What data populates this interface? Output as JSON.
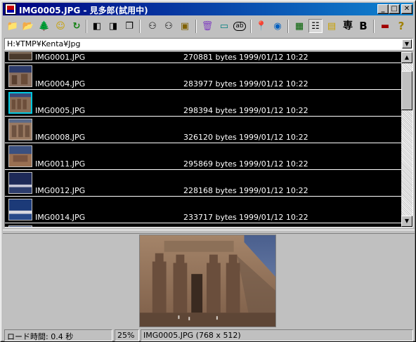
{
  "window": {
    "title": "IMG0005.JPG - 見多郎(試用中)",
    "controls": {
      "minimize": "_",
      "maximize": "□",
      "close": "✕"
    }
  },
  "toolbar": {
    "buttons": [
      {
        "icon": "folder-up-icon",
        "glyph": "📁"
      },
      {
        "icon": "open-folder-icon",
        "glyph": "📂"
      },
      {
        "icon": "tree-icon",
        "glyph": "🌲"
      },
      {
        "icon": "smiley-icon",
        "glyph": "☺"
      },
      {
        "icon": "refresh-icon",
        "glyph": "↻"
      },
      {
        "icon": "prev-page-icon",
        "glyph": "◧"
      },
      {
        "icon": "next-page-icon",
        "glyph": "◨"
      },
      {
        "icon": "copy-page-icon",
        "glyph": "❐"
      },
      {
        "icon": "binoculars-icon",
        "glyph": "⚇"
      },
      {
        "icon": "binoculars-find-next-icon",
        "glyph": "⚇"
      },
      {
        "icon": "monitor-icon",
        "glyph": "▣"
      },
      {
        "icon": "trash-icon",
        "glyph": "🗑"
      },
      {
        "icon": "card-icon",
        "glyph": "▭"
      },
      {
        "icon": "ab-icon",
        "glyph": "ab"
      },
      {
        "icon": "pin-icon",
        "glyph": "📍"
      },
      {
        "icon": "globe-icon",
        "glyph": "◉"
      },
      {
        "icon": "large-icons-view-icon",
        "glyph": "▦"
      },
      {
        "icon": "details-view-icon",
        "glyph": "☷"
      },
      {
        "icon": "color-view-icon",
        "glyph": "▤"
      },
      {
        "icon": "senyo-icon",
        "glyph": "専"
      },
      {
        "icon": "bold-icon",
        "glyph": "B"
      },
      {
        "icon": "slideshow-icon",
        "glyph": "▬"
      },
      {
        "icon": "help-icon",
        "glyph": "?"
      }
    ]
  },
  "path": {
    "value": "H:¥TMP¥Kenta¥Jpg"
  },
  "files": [
    {
      "name": "IMG0001.JPG",
      "size": "270881 bytes",
      "date": "1999/01/12 10:22",
      "selected": false
    },
    {
      "name": "IMG0004.JPG",
      "size": "283977 bytes",
      "date": "1999/01/12 10:22",
      "selected": false
    },
    {
      "name": "IMG0005.JPG",
      "size": "298394 bytes",
      "date": "1999/01/12 10:22",
      "selected": true
    },
    {
      "name": "IMG0008.JPG",
      "size": "326120 bytes",
      "date": "1999/01/12 10:22",
      "selected": false
    },
    {
      "name": "IMG0011.JPG",
      "size": "295869 bytes",
      "date": "1999/01/12 10:22",
      "selected": false
    },
    {
      "name": "IMG0012.JPG",
      "size": "228168 bytes",
      "date": "1999/01/12 10:22",
      "selected": false
    },
    {
      "name": "IMG0014.JPG",
      "size": "233717 bytes",
      "date": "1999/01/12 10:22",
      "selected": false
    }
  ],
  "status": {
    "load_time": "ロード時間: 0.4 秒",
    "zoom": "25%",
    "image_info": "IMG0005.JPG (768 x 512)"
  },
  "colors": {
    "title_start": "#000080",
    "title_end": "#1084d0",
    "list_bg": "#000000",
    "selection": "#00c8e0"
  }
}
